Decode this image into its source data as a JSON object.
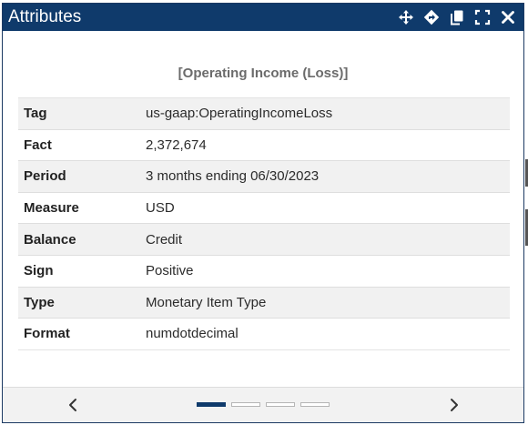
{
  "dialog": {
    "title": "Attributes",
    "heading": "[Operating Income (Loss)]",
    "toolbar_icons": [
      "move-icon",
      "navigate-icon",
      "copy-icon",
      "expand-icon",
      "close-icon"
    ]
  },
  "attributes": [
    {
      "key": "Tag",
      "value": "us-gaap:OperatingIncomeLoss"
    },
    {
      "key": "Fact",
      "value": "2,372,674"
    },
    {
      "key": "Period",
      "value": "3 months ending 06/30/2023"
    },
    {
      "key": "Measure",
      "value": "USD"
    },
    {
      "key": "Balance",
      "value": "Credit"
    },
    {
      "key": "Sign",
      "value": "Positive"
    },
    {
      "key": "Type",
      "value": "Monetary Item Type"
    },
    {
      "key": "Format",
      "value": "numdotdecimal"
    }
  ],
  "footer": {
    "prev_icon": "chevron-left-icon",
    "next_icon": "chevron-right-icon",
    "pages": 4,
    "active_page": 1
  },
  "colors": {
    "titlebar": "#0f3a6b",
    "row_alt": "#f1f1f1",
    "footer_bg": "#f2f2f2"
  }
}
